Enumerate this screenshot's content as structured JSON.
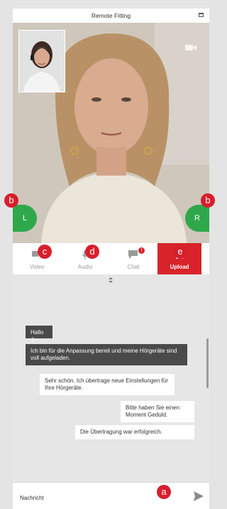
{
  "window": {
    "title": "Remote Fitting"
  },
  "video": {
    "left_button": "L",
    "right_button": "R"
  },
  "markers": {
    "a": "a",
    "b": "b",
    "c": "c",
    "d": "d",
    "e": "e"
  },
  "toolbar": {
    "items": [
      {
        "label": "Video",
        "icon": "video-camera-icon"
      },
      {
        "label": "Audio",
        "icon": "microphone-icon"
      },
      {
        "label": "Chat",
        "icon": "chat-icon",
        "badge": "!"
      },
      {
        "label": "Upload",
        "icon": "upload-icon",
        "active": true
      }
    ]
  },
  "chat": {
    "messages": [
      {
        "from": "remote",
        "text": "Hallo :)"
      },
      {
        "from": "remote",
        "text": "Ich bin für die Anpassung bereit und meine Hörgeräte sind voll aufgeladen."
      },
      {
        "from": "local",
        "text": "Sehr schön. Ich übertrage neue Einstellungen für Ihre Hörgeräte."
      },
      {
        "from": "local",
        "text": "Bitte haben Sie einen Moment Geduld."
      },
      {
        "from": "local",
        "text": "Die Übertragung war erfolgreich."
      }
    ]
  },
  "input": {
    "placeholder": "Nachricht"
  },
  "colors": {
    "accent": "#d8232a",
    "marker": "#d81e2c",
    "side_button": "#2ea84a",
    "incoming_bubble": "#4a4a4a"
  }
}
